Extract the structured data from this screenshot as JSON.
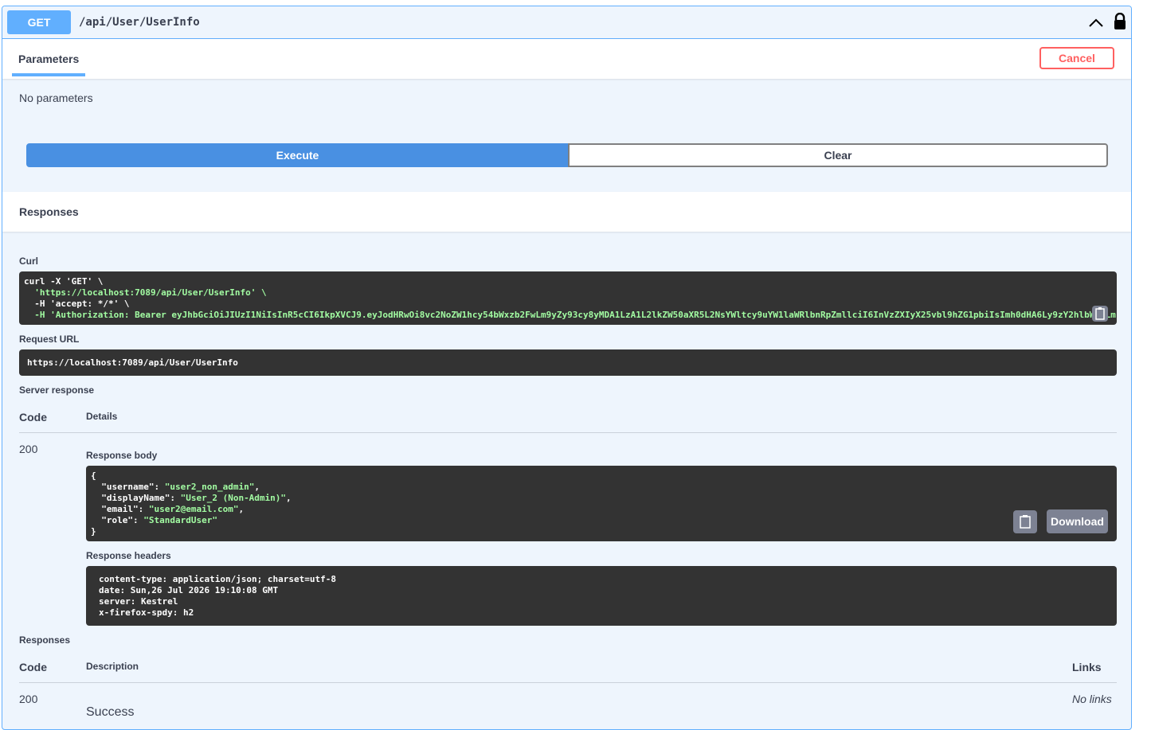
{
  "operation": {
    "method": "GET",
    "path": "/api/User/UserInfo"
  },
  "parameters": {
    "tab_label": "Parameters",
    "cancel_label": "Cancel",
    "empty_text": "No parameters"
  },
  "actions": {
    "execute_label": "Execute",
    "clear_label": "Clear"
  },
  "responses_header": "Responses",
  "curl": {
    "label": "Curl",
    "lines": [
      "curl -X 'GET' \\",
      "  'https://localhost:7089/api/User/UserInfo' \\",
      "  -H 'accept: */*' \\",
      "  -H 'Authorization: Bearer eyJhbGciOiJIUzI1NiIsInR5cCI6IkpXVCJ9.eyJodHRwOi8vc2NoZW1hcy54bWxzb2FwLm9yZy93cy8yMDA1LzA1L2lkZW50aXR5L2NsYWltcy9uYW1laWRlbnRpZmllciI6InVzZXIyX25vbl9hZG1pbiIsImh0dHA6Ly9zY2hlbWFzLm"
    ]
  },
  "request_url": {
    "label": "Request URL",
    "value": "https://localhost:7089/api/User/UserInfo"
  },
  "server_response": {
    "label": "Server response",
    "col_code": "Code",
    "col_details": "Details",
    "code": "200",
    "body_label": "Response body",
    "body": {
      "open": "{",
      "close": "}",
      "pairs": [
        {
          "key": "\"username\"",
          "value": "\"user2_non_admin\"",
          "sep": ","
        },
        {
          "key": "\"displayName\"",
          "value": "\"User_2 (Non-Admin)\"",
          "sep": ","
        },
        {
          "key": "\"email\"",
          "value": "\"user2@email.com\"",
          "sep": ","
        },
        {
          "key": "\"role\"",
          "value": "\"StandardUser\"",
          "sep": ""
        }
      ]
    },
    "download_label": "Download",
    "headers_label": "Response headers",
    "headers": [
      "content-type: application/json; charset=utf-8",
      "date: Sun,26 Jul 2026 19:10:08 GMT",
      "server: Kestrel",
      "x-firefox-spdy: h2"
    ]
  },
  "responses": {
    "label": "Responses",
    "col_code": "Code",
    "col_description": "Description",
    "col_links": "Links",
    "rows": [
      {
        "code": "200",
        "description": "Success",
        "links": "No links"
      }
    ]
  },
  "colors": {
    "get": "#61affe",
    "execute": "#4990e2",
    "cancel": "#ff6060",
    "code_bg": "#333333",
    "string": "#a2fca2"
  }
}
